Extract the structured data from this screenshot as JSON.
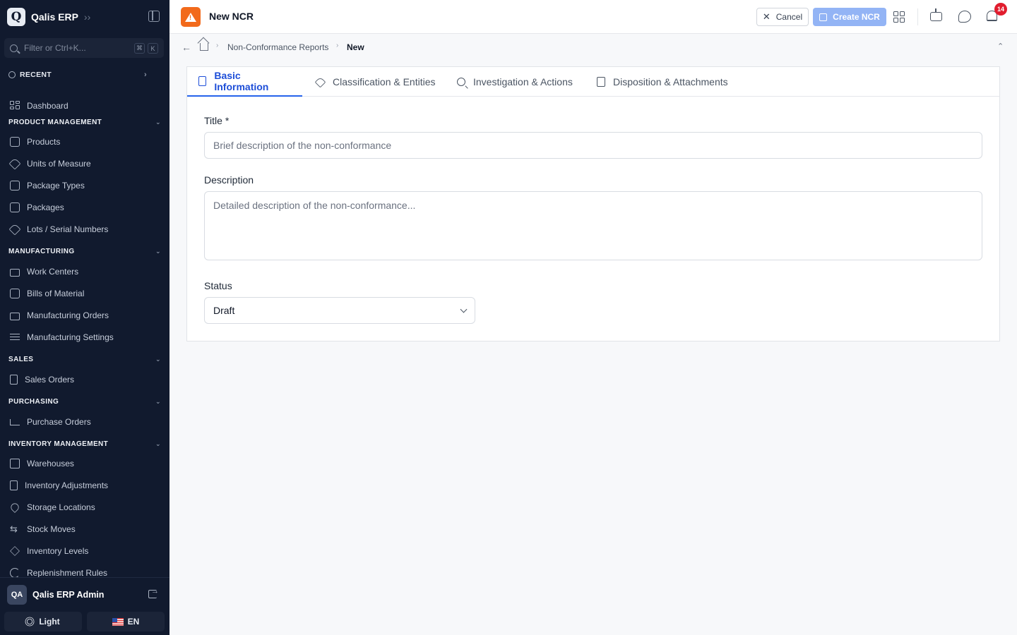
{
  "sidebar": {
    "brand": "Qalis ERP",
    "logo_letter": "Q",
    "filter_placeholder": "Filter or Ctrl+K...",
    "kbd_cmd": "⌘",
    "kbd_k": "K",
    "recent_label": "RECENT",
    "dashboard_label": "Dashboard",
    "sections": {
      "product_management": "PRODUCT MANAGEMENT",
      "manufacturing": "MANUFACTURING",
      "sales": "SALES",
      "purchasing": "PURCHASING",
      "inventory_management": "INVENTORY MANAGEMENT"
    },
    "items": {
      "products": "Products",
      "units_of_measure": "Units of Measure",
      "package_types": "Package Types",
      "packages": "Packages",
      "lots_serial": "Lots / Serial Numbers",
      "work_centers": "Work Centers",
      "bills_of_material": "Bills of Material",
      "manufacturing_orders": "Manufacturing Orders",
      "manufacturing_settings": "Manufacturing Settings",
      "sales_orders": "Sales Orders",
      "purchase_orders": "Purchase Orders",
      "warehouses": "Warehouses",
      "inventory_adjustments": "Inventory Adjustments",
      "storage_locations": "Storage Locations",
      "stock_moves": "Stock Moves",
      "inventory_levels": "Inventory Levels",
      "replenishment_rules": "Replenishment Rules"
    },
    "user": {
      "initials": "QA",
      "name": "Qalis ERP Admin"
    },
    "theme_label": "Light",
    "language_label": "EN"
  },
  "header": {
    "title": "New NCR",
    "cancel_label": "Cancel",
    "create_label": "Create NCR",
    "notification_count": "14",
    "accent_color": "#f26a1b"
  },
  "breadcrumb": {
    "parent": "Non-Conformance Reports",
    "current": "New"
  },
  "tabs": {
    "basic": "Basic Information",
    "classification": "Classification & Entities",
    "investigation": "Investigation & Actions",
    "disposition": "Disposition & Attachments"
  },
  "form": {
    "title_label": "Title *",
    "title_placeholder": "Brief description of the non-conformance",
    "description_label": "Description",
    "description_placeholder": "Detailed description of the non-conformance...",
    "status_label": "Status",
    "status_value": "Draft"
  }
}
